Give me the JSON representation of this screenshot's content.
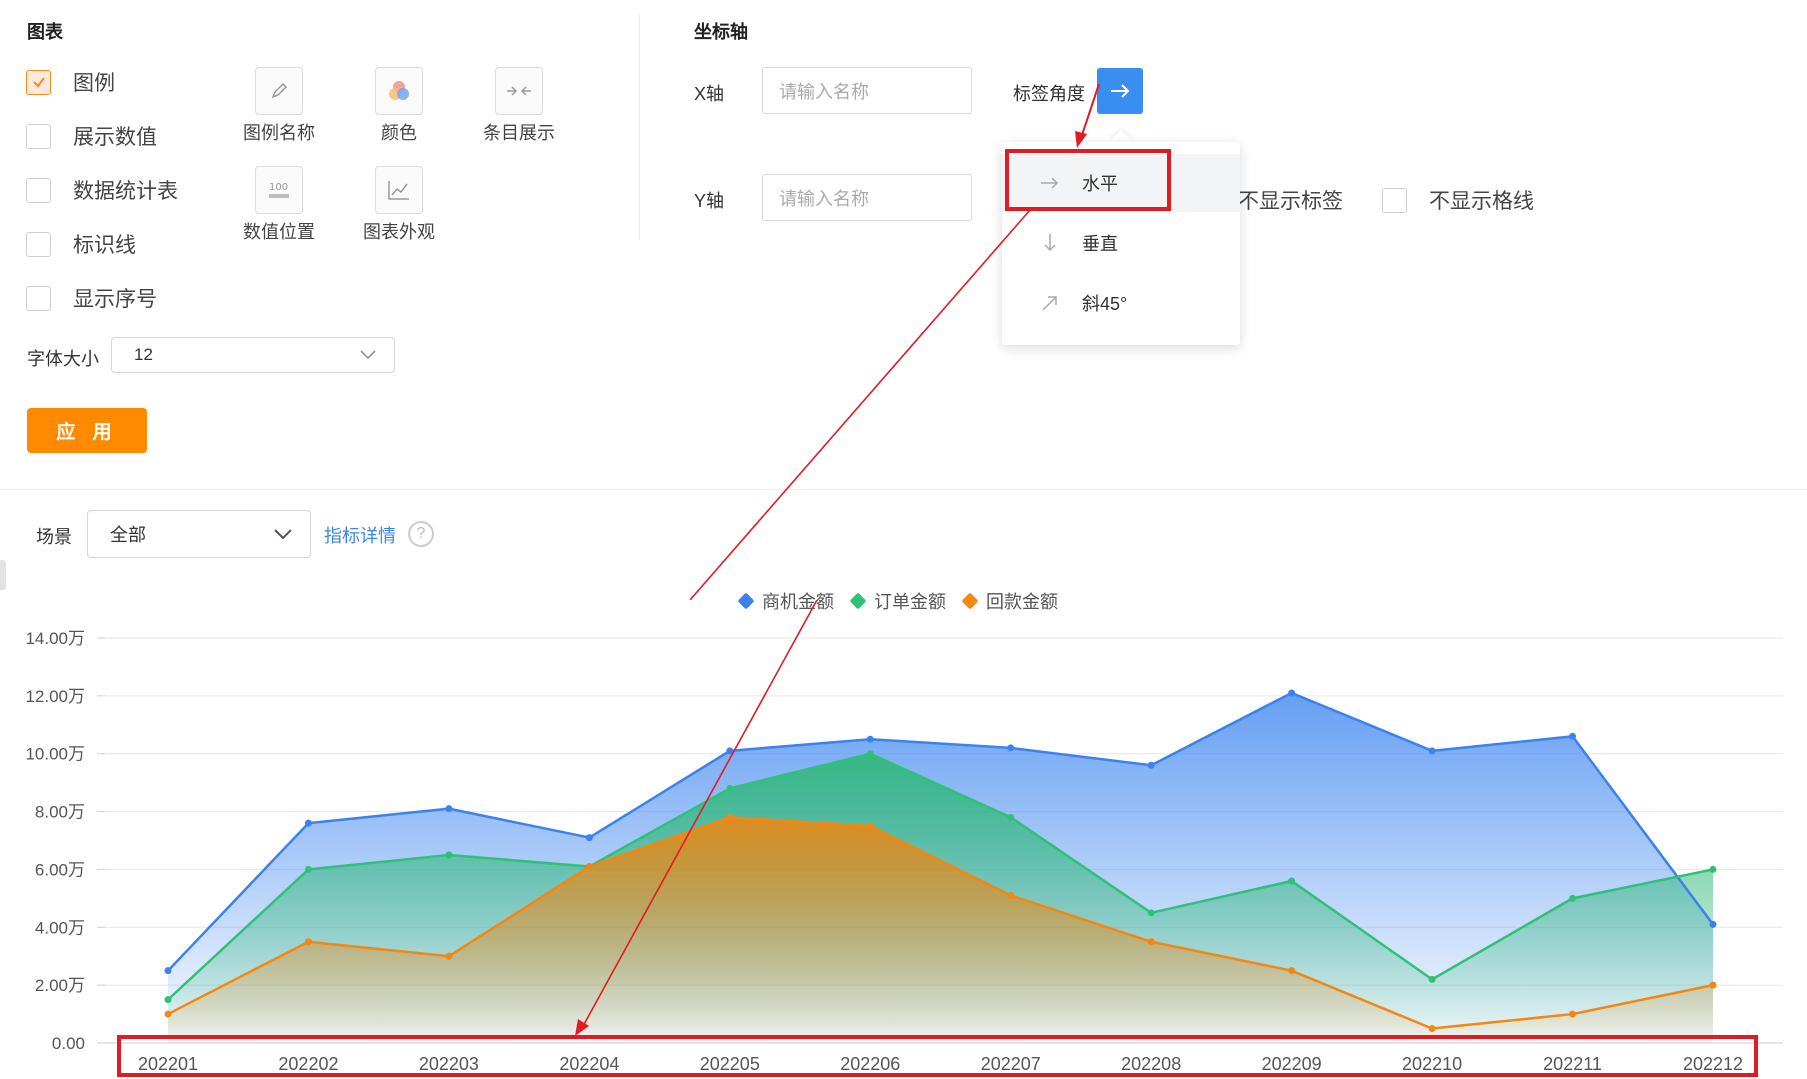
{
  "chart_panel": {
    "title": "图表",
    "checkboxes": [
      {
        "label": "图例",
        "checked": true
      },
      {
        "label": "展示数值",
        "checked": false
      },
      {
        "label": "数据统计表",
        "checked": false
      },
      {
        "label": "标识线",
        "checked": false
      },
      {
        "label": "显示序号",
        "checked": false
      }
    ],
    "tools": [
      {
        "label": "图例名称",
        "icon": "pencil-icon"
      },
      {
        "label": "颜色",
        "icon": "color-palette-icon"
      },
      {
        "label": "条目展示",
        "icon": "compress-arrows-icon"
      },
      {
        "label": "数值位置",
        "icon": "value-position-icon"
      },
      {
        "label": "图表外观",
        "icon": "line-chart-icon"
      }
    ],
    "font_size_label": "字体大小",
    "font_size_value": "12",
    "apply_label": "应 用"
  },
  "axis_panel": {
    "title": "坐标轴",
    "x_label": "X轴",
    "y_label": "Y轴",
    "name_placeholder": "请输入名称",
    "label_angle": "标签角度",
    "dropdown": [
      {
        "label": "水平",
        "icon": "arrow-right-icon",
        "active": true
      },
      {
        "label": "垂直",
        "icon": "arrow-down-icon",
        "active": false
      },
      {
        "label": "斜45°",
        "icon": "arrow-diagonal-icon",
        "active": false
      }
    ],
    "hide_labels": "不显示标签",
    "hide_gridlines": "不显示格线"
  },
  "filter": {
    "scene_label": "场景",
    "scene_value": "全部",
    "indicator_link": "指标详情",
    "help_symbol": "?"
  },
  "colors": {
    "blue": "#3b82f0",
    "green": "#2fc176",
    "orange": "#f5860f",
    "accent": "#ff8a00",
    "highlight": "#e01b24"
  },
  "chart_data": {
    "type": "area",
    "categories": [
      "202201",
      "202202",
      "202203",
      "202204",
      "202205",
      "202206",
      "202207",
      "202208",
      "202209",
      "202210",
      "202211",
      "202212"
    ],
    "series": [
      {
        "name": "商机金额",
        "color": "#3b82f0",
        "values": [
          2.5,
          7.6,
          8.1,
          7.1,
          10.1,
          10.5,
          10.2,
          9.6,
          12.1,
          10.1,
          10.6,
          4.1
        ]
      },
      {
        "name": "订单金额",
        "color": "#2fc176",
        "values": [
          1.5,
          6.0,
          6.5,
          6.1,
          8.8,
          10.0,
          7.8,
          4.5,
          5.6,
          2.2,
          5.0,
          6.0
        ]
      },
      {
        "name": "回款金额",
        "color": "#f5860f",
        "values": [
          1.0,
          3.5,
          3.0,
          6.1,
          7.8,
          7.5,
          5.1,
          3.5,
          2.5,
          0.5,
          1.0,
          2.0
        ]
      }
    ],
    "y_ticks": [
      "0.00",
      "2.00万",
      "4.00万",
      "6.00万",
      "8.00万",
      "10.00万",
      "12.00万",
      "14.00万"
    ],
    "ylim": [
      0,
      14
    ],
    "grid": true,
    "legend": "top-center"
  }
}
